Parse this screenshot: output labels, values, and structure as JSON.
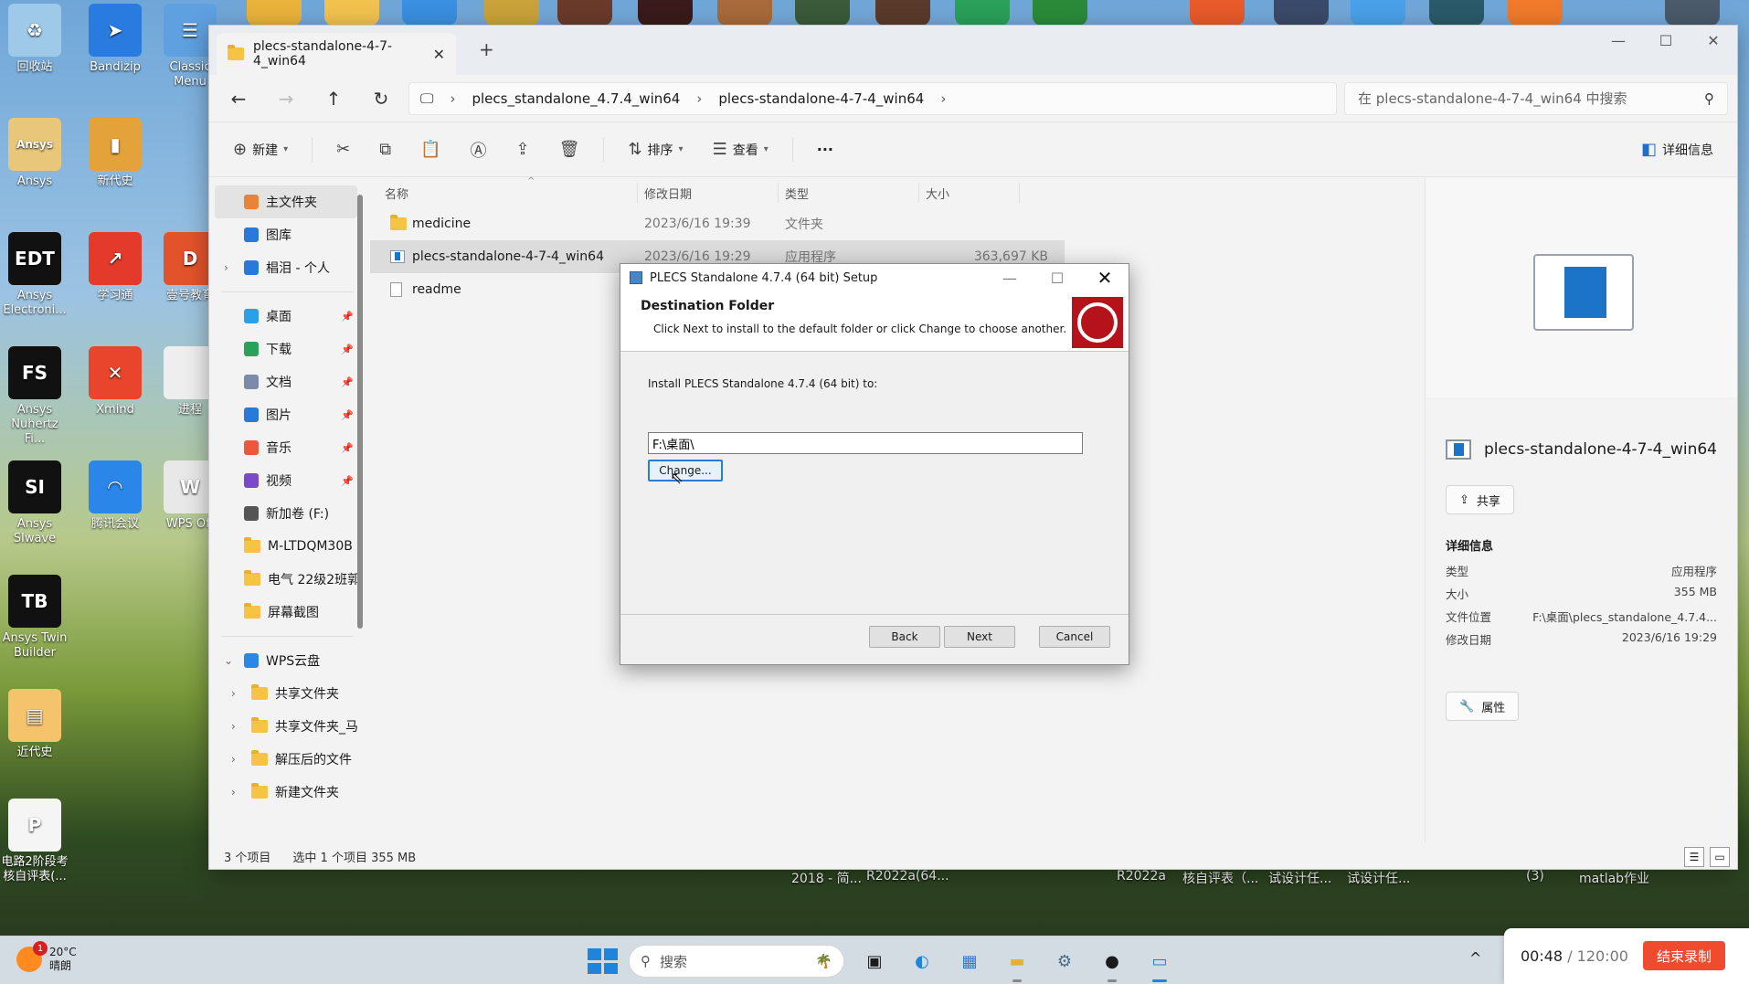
{
  "desktop": {
    "icons": [
      {
        "label": "回收站",
        "color": "#9ec9e8",
        "glyph": "♻"
      },
      {
        "label": "Bandizip",
        "color": "#2a7be0",
        "glyph": "➤"
      },
      {
        "label": "Classic Menu",
        "color": "#5fa0e0",
        "glyph": "☰"
      },
      {
        "label": "Ansys",
        "color": "#e8c77a",
        "glyph": "Ansys"
      },
      {
        "label": "新代史",
        "color": "#e3a23a",
        "glyph": "▮"
      },
      {
        "label": "Ansys Electroni...",
        "color": "#111111",
        "glyph": "EDT"
      },
      {
        "label": "学习通",
        "color": "#e33a2b",
        "glyph": "↗"
      },
      {
        "label": "壹号教育",
        "color": "#e3532b",
        "glyph": "D"
      },
      {
        "label": "Ansys Nuhertz Fi...",
        "color": "#111111",
        "glyph": "FS"
      },
      {
        "label": "Xmind",
        "color": "#e8452c",
        "glyph": "✕"
      },
      {
        "label": "进程",
        "color": "#eeeeee",
        "glyph": ""
      },
      {
        "label": "Ansys SIwave",
        "color": "#111111",
        "glyph": "SI"
      },
      {
        "label": "腾讯会议",
        "color": "#2a86e8",
        "glyph": "◠"
      },
      {
        "label": "WPS Off",
        "color": "#e8e8e8",
        "glyph": "W"
      },
      {
        "label": "Ansys Twin Builder",
        "color": "#111111",
        "glyph": "TB"
      },
      {
        "label": "近代史",
        "color": "#f5c36b",
        "glyph": "▤"
      },
      {
        "label": "电路2阶段考核自评表(...",
        "color": "#f5f5f5",
        "glyph": "P"
      }
    ],
    "bottom_labels": [
      "2018 - 简...",
      "R2022a(64...",
      "R2022a",
      "核自评表（...",
      "试设计任...",
      "试设计任...",
      "(3)",
      "matlab作业"
    ]
  },
  "explorer": {
    "tab_title": "plecs-standalone-4-7-4_win64",
    "address": [
      "plecs_standalone_4.7.4_win64",
      "plecs-standalone-4-7-4_win64"
    ],
    "search_placeholder": "在 plecs-standalone-4-7-4_win64 中搜索",
    "toolbar": {
      "new": "新建",
      "sort": "排序",
      "view": "查看",
      "more": "···",
      "details": "详细信息"
    },
    "sidebar": [
      {
        "label": "主文件夹",
        "icon": "home-icon",
        "color": "#e8843a",
        "active": true
      },
      {
        "label": "图库",
        "icon": "gallery-icon",
        "color": "#2a78d8"
      },
      {
        "label": "椙泪 - 个人",
        "icon": "cloud-icon",
        "color": "#2a78d8",
        "expand": true
      },
      {
        "sep": true
      },
      {
        "label": "桌面",
        "icon": "desktop-icon",
        "color": "#2aa0e8",
        "pin": true
      },
      {
        "label": "下载",
        "icon": "download-icon",
        "color": "#2aa05a",
        "pin": true
      },
      {
        "label": "文档",
        "icon": "document-icon",
        "color": "#7a8aa8",
        "pin": true
      },
      {
        "label": "图片",
        "icon": "pictures-icon",
        "color": "#2a78d8",
        "pin": true
      },
      {
        "label": "音乐",
        "icon": "music-icon",
        "color": "#e85a3a",
        "pin": true
      },
      {
        "label": "视频",
        "icon": "video-icon",
        "color": "#7a4ac8",
        "pin": true
      },
      {
        "label": "新加卷 (F:)",
        "icon": "drive-icon",
        "color": "#555555"
      },
      {
        "label": "M-LTDQM30B",
        "icon": "folder-icon",
        "color": "#f6c344"
      },
      {
        "label": "电气 22级2班郭",
        "icon": "folder-icon",
        "color": "#f6c344"
      },
      {
        "label": "屏幕截图",
        "icon": "folder-icon",
        "color": "#f6c344"
      },
      {
        "sep": true
      },
      {
        "label": "WPS云盘",
        "icon": "cloud-icon",
        "color": "#2a86e8",
        "expand": "open"
      },
      {
        "label": "共享文件夹",
        "icon": "folder-icon",
        "color": "#f6c344",
        "child": true
      },
      {
        "label": "共享文件夹_马",
        "icon": "folder-icon",
        "color": "#f6c344",
        "child": true
      },
      {
        "label": "解压后的文件",
        "icon": "folder-icon",
        "color": "#f6c344",
        "child": true
      },
      {
        "label": "新建文件夹",
        "icon": "folder-icon",
        "color": "#f6c344",
        "child": true
      }
    ],
    "columns": {
      "name": "名称",
      "date": "修改日期",
      "type": "类型",
      "size": "大小"
    },
    "files": [
      {
        "name": "medicine",
        "date": "2023/6/16 19:39",
        "type": "文件夹",
        "size": "",
        "kind": "folder"
      },
      {
        "name": "plecs-standalone-4-7-4_win64",
        "date": "2023/6/16 19:29",
        "type": "应用程序",
        "size": "363,697 KB",
        "kind": "exe",
        "selected": true
      },
      {
        "name": "readme",
        "date": "",
        "type": "",
        "size": "",
        "kind": "doc"
      }
    ],
    "details": {
      "title": "plecs-standalone-4-7-4_win64",
      "share": "共享",
      "heading": "详细信息",
      "props": [
        {
          "k": "类型",
          "v": "应用程序"
        },
        {
          "k": "大小",
          "v": "355 MB"
        },
        {
          "k": "文件位置",
          "v": "F:\\桌面\\plecs_standalone_4.7.4..."
        },
        {
          "k": "修改日期",
          "v": "2023/6/16 19:29"
        }
      ],
      "properties": "属性"
    },
    "status": {
      "count": "3 个项目",
      "selection": "选中 1 个项目  355 MB"
    }
  },
  "dialog": {
    "title": "PLECS Standalone 4.7.4 (64 bit) Setup",
    "heading": "Destination Folder",
    "subheading": "Click Next to install to the default folder or click Change to choose another.",
    "label": "Install PLECS Standalone 4.7.4 (64 bit) to:",
    "path": "F:\\桌面\\",
    "change": "Change...",
    "back": "Back",
    "next": "Next",
    "cancel": "Cancel"
  },
  "taskbar": {
    "temp": "20°C",
    "weather": "晴朗",
    "badge": "1",
    "search": "搜索",
    "recorder_time": "00:48",
    "recorder_total": "/ 120:00",
    "recorder_end": "结束录制"
  }
}
